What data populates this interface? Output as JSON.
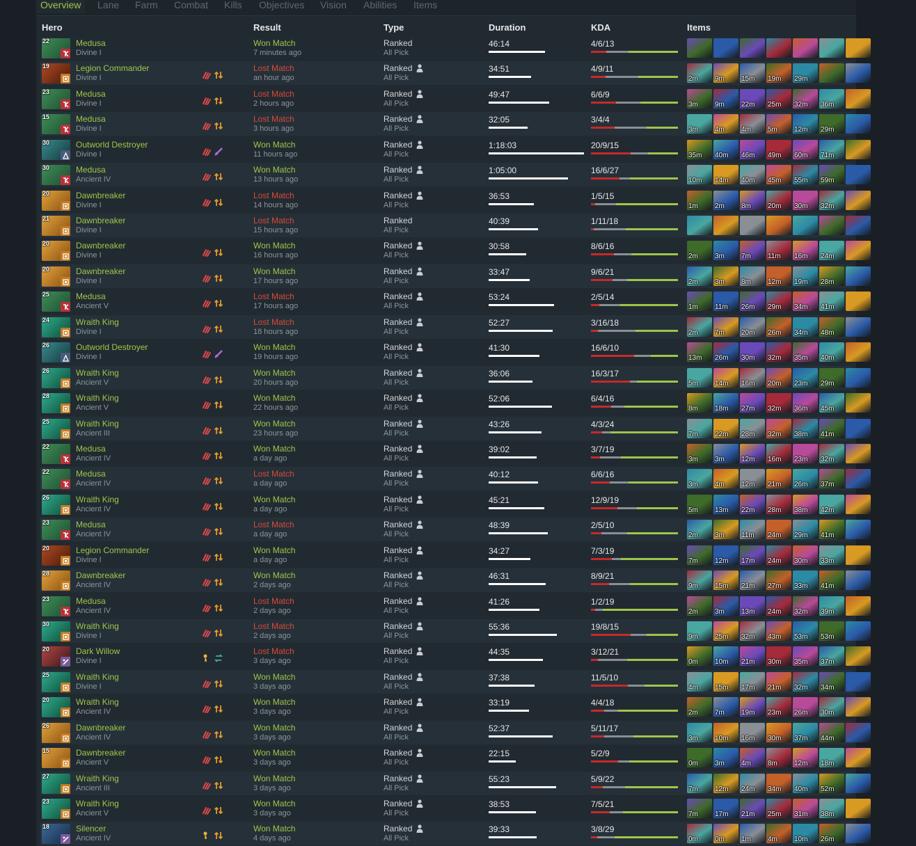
{
  "tabs": [
    "Overview",
    "Lane",
    "Farm",
    "Combat",
    "Kills",
    "Objectives",
    "Vision",
    "Abilities",
    "Items"
  ],
  "headers": {
    "hero": "Hero",
    "result": "Result",
    "type": "Type",
    "duration": "Duration",
    "kda": "KDA",
    "items": "Items"
  },
  "colors": {
    "won": "#9ec64a",
    "lost": "#d84a3a",
    "kda_kills": "#c62a2a",
    "kda_deaths": "#8a8f94",
    "kda_assists": "#9ec64a"
  },
  "hero_colors": {
    "Medusa": [
      "#3f8f5a",
      "#1f4d2f"
    ],
    "Legion Commander": [
      "#b04a22",
      "#4a1a0c"
    ],
    "Outworld Destroyer": [
      "#3c8a8f",
      "#123a3d"
    ],
    "Dawnbreaker": [
      "#e2a33c",
      "#8a4f12"
    ],
    "Wraith King": [
      "#2fae8c",
      "#0f4a3a"
    ],
    "Dark Willow": [
      "#b24848",
      "#3d1616"
    ],
    "Silencer": [
      "#3c6a9a",
      "#162a44"
    ]
  },
  "role_colors": {
    "carry": "#b8323a",
    "offlane": "#c27c22",
    "mid": "#4a5a7a",
    "support": "#7a5a9a"
  },
  "icon_palette": [
    "#6a4ab8",
    "#2c8aa4",
    "#d89a22",
    "#a52a3a",
    "#3e6a2a",
    "#8a8f96",
    "#b84a9a",
    "#2a5aa8",
    "#c4602a",
    "#4aa6a0"
  ],
  "matches": [
    {
      "hero": "Medusa",
      "level": "22",
      "role": "carry",
      "rank": "Divine I",
      "result": "Won Match",
      "won": true,
      "ago": "7 minutes ago",
      "type": "Ranked",
      "party": false,
      "mode": "All Pick",
      "duration": "46:14",
      "duration_sec": 2774,
      "kda": "4/6/13",
      "k": 4,
      "d": 6,
      "a": 13,
      "badges": [],
      "items": [
        "",
        "",
        "",
        "",
        "",
        "",
        ""
      ]
    },
    {
      "hero": "Legion Commander",
      "level": "19",
      "role": "offlane",
      "rank": "Divine I",
      "result": "Lost Match",
      "won": false,
      "ago": "an hour ago",
      "type": "Ranked",
      "party": true,
      "mode": "All Pick",
      "duration": "34:51",
      "duration_sec": 2091,
      "kda": "4/9/11",
      "k": 4,
      "d": 9,
      "a": 11,
      "badges": [
        "claw-icon",
        "swap-lanes-icon"
      ],
      "items": [
        "2m",
        "9m",
        "15m",
        "19m",
        "29m",
        "",
        ""
      ]
    },
    {
      "hero": "Medusa",
      "level": "23",
      "role": "carry",
      "rank": "Divine I",
      "result": "Lost Match",
      "won": false,
      "ago": "2 hours ago",
      "type": "Ranked",
      "party": true,
      "mode": "All Pick",
      "duration": "49:47",
      "duration_sec": 2987,
      "kda": "6/6/9",
      "k": 6,
      "d": 6,
      "a": 9,
      "badges": [
        "claw-icon",
        "swap-lanes-icon"
      ],
      "items": [
        "3m",
        "9m",
        "22m",
        "25m",
        "32m",
        "36m",
        ""
      ]
    },
    {
      "hero": "Medusa",
      "level": "15",
      "role": "carry",
      "rank": "Divine I",
      "result": "Lost Match",
      "won": false,
      "ago": "3 hours ago",
      "type": "Ranked",
      "party": true,
      "mode": "All Pick",
      "duration": "32:05",
      "duration_sec": 1925,
      "kda": "3/4/4",
      "k": 3,
      "d": 4,
      "a": 4,
      "badges": [
        "claw-icon",
        "swap-lanes-icon"
      ],
      "items": [
        "3m",
        "4m",
        "4m",
        "5m",
        "12m",
        "29m",
        ""
      ]
    },
    {
      "hero": "Outworld Destroyer",
      "level": "30",
      "role": "mid",
      "rank": "Divine I",
      "result": "Won Match",
      "won": true,
      "ago": "11 hours ago",
      "type": "Ranked",
      "party": true,
      "mode": "All Pick",
      "duration": "1:18:03",
      "duration_sec": 4683,
      "kda": "20/9/15",
      "k": 20,
      "d": 9,
      "a": 15,
      "badges": [
        "claw-icon",
        "sword-icon"
      ],
      "items": [
        "35m",
        "40m",
        "46m",
        "49m",
        "60m",
        "71m",
        ""
      ]
    },
    {
      "hero": "Medusa",
      "level": "30",
      "role": "carry",
      "rank": "Ancient IV",
      "result": "Won Match",
      "won": true,
      "ago": "13 hours ago",
      "type": "Ranked",
      "party": true,
      "mode": "All Pick",
      "duration": "1:05:00",
      "duration_sec": 3900,
      "kda": "16/6/27",
      "k": 16,
      "d": 6,
      "a": 27,
      "badges": [
        "claw-icon",
        "swap-lanes-icon"
      ],
      "items": [
        "10m",
        "14m",
        "40m",
        "45m",
        "55m",
        "59m",
        ""
      ]
    },
    {
      "hero": "Dawnbreaker",
      "level": "20",
      "role": "offlane",
      "rank": "Divine I",
      "result": "Lost Match",
      "won": false,
      "ago": "14 hours ago",
      "type": "Ranked",
      "party": true,
      "mode": "All Pick",
      "duration": "36:53",
      "duration_sec": 2213,
      "kda": "1/5/15",
      "k": 1,
      "d": 5,
      "a": 15,
      "badges": [
        "claw-icon",
        "swap-lanes-icon"
      ],
      "items": [
        "1m",
        "2m",
        "8m",
        "20m",
        "30m",
        "32m",
        ""
      ]
    },
    {
      "hero": "Dawnbreaker",
      "level": "21",
      "role": "offlane",
      "rank": "Divine I",
      "result": "Lost Match",
      "won": false,
      "ago": "15 hours ago",
      "type": "Ranked",
      "party": false,
      "mode": "All Pick",
      "duration": "40:39",
      "duration_sec": 2439,
      "kda": "1/11/18",
      "k": 1,
      "d": 11,
      "a": 18,
      "badges": [],
      "items": [
        "",
        "",
        "",
        "",
        "",
        "",
        ""
      ]
    },
    {
      "hero": "Dawnbreaker",
      "level": "20",
      "role": "offlane",
      "rank": "Divine I",
      "result": "Won Match",
      "won": true,
      "ago": "16 hours ago",
      "type": "Ranked",
      "party": true,
      "mode": "All Pick",
      "duration": "30:58",
      "duration_sec": 1858,
      "kda": "8/6/16",
      "k": 8,
      "d": 6,
      "a": 16,
      "badges": [
        "claw-icon",
        "swap-lanes-icon"
      ],
      "items": [
        "2m",
        "3m",
        "7m",
        "11m",
        "16m",
        "24m",
        ""
      ]
    },
    {
      "hero": "Dawnbreaker",
      "level": "20",
      "role": "offlane",
      "rank": "Divine I",
      "result": "Won Match",
      "won": true,
      "ago": "17 hours ago",
      "type": "Ranked",
      "party": true,
      "mode": "All Pick",
      "duration": "33:47",
      "duration_sec": 2027,
      "kda": "9/6/21",
      "k": 9,
      "d": 6,
      "a": 21,
      "badges": [
        "claw-icon",
        "swap-lanes-icon"
      ],
      "items": [
        "2m",
        "3m",
        "8m",
        "12m",
        "19m",
        "28m",
        ""
      ]
    },
    {
      "hero": "Medusa",
      "level": "25",
      "role": "carry",
      "rank": "Ancient V",
      "result": "Lost Match",
      "won": false,
      "ago": "17 hours ago",
      "type": "Ranked",
      "party": true,
      "mode": "All Pick",
      "duration": "53:24",
      "duration_sec": 3204,
      "kda": "2/5/14",
      "k": 2,
      "d": 5,
      "a": 14,
      "badges": [
        "claw-icon",
        "swap-lanes-icon"
      ],
      "items": [
        "1m",
        "11m",
        "26m",
        "29m",
        "34m",
        "41m",
        ""
      ]
    },
    {
      "hero": "Wraith King",
      "level": "24",
      "role": "offlane",
      "rank": "Divine I",
      "result": "Lost Match",
      "won": false,
      "ago": "18 hours ago",
      "type": "Ranked",
      "party": true,
      "mode": "All Pick",
      "duration": "52:27",
      "duration_sec": 3147,
      "kda": "3/16/18",
      "k": 3,
      "d": 16,
      "a": 18,
      "badges": [
        "claw-icon",
        "swap-lanes-icon"
      ],
      "items": [
        "2m",
        "7m",
        "20m",
        "26m",
        "34m",
        "48m",
        ""
      ]
    },
    {
      "hero": "Outworld Destroyer",
      "level": "26",
      "role": "mid",
      "rank": "Divine I",
      "result": "Won Match",
      "won": true,
      "ago": "19 hours ago",
      "type": "Ranked",
      "party": true,
      "mode": "All Pick",
      "duration": "41:30",
      "duration_sec": 2490,
      "kda": "16/6/10",
      "k": 16,
      "d": 6,
      "a": 10,
      "badges": [
        "claw-icon",
        "sword-icon"
      ],
      "items": [
        "13m",
        "26m",
        "30m",
        "32m",
        "35m",
        "40m",
        ""
      ]
    },
    {
      "hero": "Wraith King",
      "level": "26",
      "role": "offlane",
      "rank": "Ancient V",
      "result": "Won Match",
      "won": true,
      "ago": "20 hours ago",
      "type": "Ranked",
      "party": true,
      "mode": "All Pick",
      "duration": "36:06",
      "duration_sec": 2166,
      "kda": "16/3/17",
      "k": 16,
      "d": 3,
      "a": 17,
      "badges": [
        "claw-icon",
        "swap-lanes-icon"
      ],
      "items": [
        "5m",
        "14m",
        "16m",
        "20m",
        "23m",
        "29m",
        ""
      ]
    },
    {
      "hero": "Wraith King",
      "level": "28",
      "role": "offlane",
      "rank": "Ancient V",
      "result": "Won Match",
      "won": true,
      "ago": "22 hours ago",
      "type": "Ranked",
      "party": true,
      "mode": "All Pick",
      "duration": "52:06",
      "duration_sec": 3126,
      "kda": "6/4/16",
      "k": 6,
      "d": 4,
      "a": 16,
      "badges": [
        "claw-icon",
        "swap-lanes-icon"
      ],
      "items": [
        "8m",
        "18m",
        "27m",
        "32m",
        "36m",
        "45m",
        ""
      ]
    },
    {
      "hero": "Wraith King",
      "level": "25",
      "role": "offlane",
      "rank": "Ancient III",
      "result": "Won Match",
      "won": true,
      "ago": "23 hours ago",
      "type": "Ranked",
      "party": true,
      "mode": "All Pick",
      "duration": "43:26",
      "duration_sec": 2606,
      "kda": "4/3/24",
      "k": 4,
      "d": 3,
      "a": 24,
      "badges": [
        "claw-icon",
        "swap-lanes-icon"
      ],
      "items": [
        "7m",
        "22m",
        "28m",
        "32m",
        "38m",
        "41m",
        ""
      ]
    },
    {
      "hero": "Medusa",
      "level": "22",
      "role": "carry",
      "rank": "Ancient IV",
      "result": "Won Match",
      "won": true,
      "ago": "a day ago",
      "type": "Ranked",
      "party": true,
      "mode": "All Pick",
      "duration": "39:02",
      "duration_sec": 2342,
      "kda": "3/7/19",
      "k": 3,
      "d": 7,
      "a": 19,
      "badges": [
        "claw-icon",
        "swap-lanes-icon"
      ],
      "items": [
        "3m",
        "3m",
        "12m",
        "16m",
        "23m",
        "32m",
        ""
      ]
    },
    {
      "hero": "Medusa",
      "level": "22",
      "role": "carry",
      "rank": "Ancient IV",
      "result": "Lost Match",
      "won": false,
      "ago": "a day ago",
      "type": "Ranked",
      "party": true,
      "mode": "All Pick",
      "duration": "40:12",
      "duration_sec": 2412,
      "kda": "6/6/16",
      "k": 6,
      "d": 6,
      "a": 16,
      "badges": [
        "claw-icon",
        "swap-lanes-icon"
      ],
      "items": [
        "3m",
        "4m",
        "12m",
        "21m",
        "26m",
        "37m",
        ""
      ]
    },
    {
      "hero": "Wraith King",
      "level": "26",
      "role": "offlane",
      "rank": "Ancient IV",
      "result": "Won Match",
      "won": true,
      "ago": "a day ago",
      "type": "Ranked",
      "party": true,
      "mode": "All Pick",
      "duration": "45:21",
      "duration_sec": 2721,
      "kda": "12/9/19",
      "k": 12,
      "d": 9,
      "a": 19,
      "badges": [
        "claw-icon",
        "swap-lanes-icon"
      ],
      "items": [
        "5m",
        "13m",
        "22m",
        "28m",
        "38m",
        "42m",
        ""
      ]
    },
    {
      "hero": "Medusa",
      "level": "23",
      "role": "carry",
      "rank": "Ancient IV",
      "result": "Lost Match",
      "won": false,
      "ago": "a day ago",
      "type": "Ranked",
      "party": true,
      "mode": "All Pick",
      "duration": "48:39",
      "duration_sec": 2919,
      "kda": "2/5/10",
      "k": 2,
      "d": 5,
      "a": 10,
      "badges": [
        "claw-icon",
        "swap-lanes-icon"
      ],
      "items": [
        "2m",
        "3m",
        "11m",
        "24m",
        "29m",
        "41m",
        ""
      ]
    },
    {
      "hero": "Legion Commander",
      "level": "20",
      "role": "offlane",
      "rank": "Divine I",
      "result": "Won Match",
      "won": true,
      "ago": "a day ago",
      "type": "Ranked",
      "party": true,
      "mode": "All Pick",
      "duration": "34:27",
      "duration_sec": 2067,
      "kda": "7/3/19",
      "k": 7,
      "d": 3,
      "a": 19,
      "badges": [
        "claw-icon",
        "swap-lanes-icon"
      ],
      "items": [
        "7m",
        "12m",
        "17m",
        "24m",
        "30m",
        "33m",
        ""
      ]
    },
    {
      "hero": "Dawnbreaker",
      "level": "28",
      "role": "offlane",
      "rank": "Ancient IV",
      "result": "Won Match",
      "won": true,
      "ago": "2 days ago",
      "type": "Ranked",
      "party": true,
      "mode": "All Pick",
      "duration": "46:31",
      "duration_sec": 2791,
      "kda": "8/9/21",
      "k": 8,
      "d": 9,
      "a": 21,
      "badges": [
        "claw-icon",
        "swap-lanes-icon"
      ],
      "items": [
        "9m",
        "15m",
        "21m",
        "27m",
        "33m",
        "41m",
        ""
      ]
    },
    {
      "hero": "Medusa",
      "level": "23",
      "role": "carry",
      "rank": "Ancient IV",
      "result": "Lost Match",
      "won": false,
      "ago": "2 days ago",
      "type": "Ranked",
      "party": true,
      "mode": "All Pick",
      "duration": "41:26",
      "duration_sec": 2486,
      "kda": "1/2/19",
      "k": 1,
      "d": 2,
      "a": 19,
      "badges": [
        "claw-icon",
        "swap-lanes-icon"
      ],
      "items": [
        "2m",
        "3m",
        "13m",
        "24m",
        "32m",
        "39m",
        ""
      ]
    },
    {
      "hero": "Wraith King",
      "level": "30",
      "role": "offlane",
      "rank": "Divine I",
      "result": "Lost Match",
      "won": false,
      "ago": "2 days ago",
      "type": "Ranked",
      "party": true,
      "mode": "All Pick",
      "duration": "55:36",
      "duration_sec": 3336,
      "kda": "19/8/15",
      "k": 19,
      "d": 8,
      "a": 15,
      "badges": [
        "claw-icon",
        "swap-lanes-icon"
      ],
      "items": [
        "9m",
        "25m",
        "32m",
        "43m",
        "53m",
        "53m",
        ""
      ]
    },
    {
      "hero": "Dark Willow",
      "level": "20",
      "role": "support",
      "rank": "Divine I",
      "result": "Lost Match",
      "won": false,
      "ago": "3 days ago",
      "type": "Ranked",
      "party": true,
      "mode": "All Pick",
      "duration": "44:35",
      "duration_sec": 2675,
      "kda": "3/12/21",
      "k": 3,
      "d": 12,
      "a": 21,
      "badges": [
        "key-icon",
        "roam-icon"
      ],
      "items": [
        "0m",
        "10m",
        "21m",
        "30m",
        "35m",
        "37m",
        ""
      ]
    },
    {
      "hero": "Wraith King",
      "level": "25",
      "role": "offlane",
      "rank": "Divine I",
      "result": "Won Match",
      "won": true,
      "ago": "3 days ago",
      "type": "Ranked",
      "party": true,
      "mode": "All Pick",
      "duration": "37:38",
      "duration_sec": 2258,
      "kda": "11/5/10",
      "k": 11,
      "d": 5,
      "a": 10,
      "badges": [
        "claw-icon",
        "swap-lanes-icon"
      ],
      "items": [
        "4m",
        "15m",
        "17m",
        "21m",
        "32m",
        "34m",
        ""
      ]
    },
    {
      "hero": "Wraith King",
      "level": "20",
      "role": "offlane",
      "rank": "Ancient IV",
      "result": "Won Match",
      "won": true,
      "ago": "3 days ago",
      "type": "Ranked",
      "party": true,
      "mode": "All Pick",
      "duration": "33:19",
      "duration_sec": 1999,
      "kda": "4/4/18",
      "k": 4,
      "d": 4,
      "a": 18,
      "badges": [
        "claw-icon",
        "swap-lanes-icon"
      ],
      "items": [
        "2m",
        "7m",
        "19m",
        "23m",
        "26m",
        "30m",
        ""
      ]
    },
    {
      "hero": "Dawnbreaker",
      "level": "26",
      "role": "offlane",
      "rank": "Ancient IV",
      "result": "Won Match",
      "won": true,
      "ago": "3 days ago",
      "type": "Ranked",
      "party": true,
      "mode": "All Pick",
      "duration": "52:37",
      "duration_sec": 3157,
      "kda": "5/11/17",
      "k": 5,
      "d": 11,
      "a": 17,
      "badges": [
        "claw-icon",
        "swap-lanes-icon"
      ],
      "items": [
        "3m",
        "10m",
        "16m",
        "30m",
        "37m",
        "44m",
        ""
      ]
    },
    {
      "hero": "Dawnbreaker",
      "level": "15",
      "role": "offlane",
      "rank": "Ancient V",
      "result": "Won Match",
      "won": true,
      "ago": "3 days ago",
      "type": "Ranked",
      "party": true,
      "mode": "All Pick",
      "duration": "22:15",
      "duration_sec": 1335,
      "kda": "5/2/9",
      "k": 5,
      "d": 2,
      "a": 9,
      "badges": [
        "claw-icon",
        "swap-lanes-icon"
      ],
      "items": [
        "0m",
        "3m",
        "4m",
        "8m",
        "12m",
        "18m",
        ""
      ]
    },
    {
      "hero": "Wraith King",
      "level": "27",
      "role": "offlane",
      "rank": "Ancient III",
      "result": "Won Match",
      "won": true,
      "ago": "3 days ago",
      "type": "Ranked",
      "party": true,
      "mode": "All Pick",
      "duration": "55:23",
      "duration_sec": 3323,
      "kda": "5/9/22",
      "k": 5,
      "d": 9,
      "a": 22,
      "badges": [
        "claw-icon",
        "swap-lanes-icon"
      ],
      "items": [
        "7m",
        "12m",
        "24m",
        "34m",
        "40m",
        "52m",
        ""
      ]
    },
    {
      "hero": "Wraith King",
      "level": "23",
      "role": "offlane",
      "rank": "Ancient V",
      "result": "Won Match",
      "won": true,
      "ago": "3 days ago",
      "type": "Ranked",
      "party": true,
      "mode": "All Pick",
      "duration": "38:53",
      "duration_sec": 2333,
      "kda": "7/5/21",
      "k": 7,
      "d": 5,
      "a": 21,
      "badges": [
        "claw-icon",
        "swap-lanes-icon"
      ],
      "items": [
        "7m",
        "17m",
        "21m",
        "25m",
        "31m",
        "38m",
        ""
      ]
    },
    {
      "hero": "Silencer",
      "level": "18",
      "role": "support",
      "rank": "Ancient IV",
      "result": "Won Match",
      "won": true,
      "ago": "4 days ago",
      "type": "Ranked",
      "party": true,
      "mode": "All Pick",
      "duration": "39:33",
      "duration_sec": 2373,
      "kda": "3/8/29",
      "k": 3,
      "d": 8,
      "a": 29,
      "badges": [
        "key-icon",
        "swap-lanes-icon"
      ],
      "items": [
        "0m",
        "0m",
        "1m",
        "4m",
        "10m",
        "26m",
        ""
      ]
    }
  ]
}
